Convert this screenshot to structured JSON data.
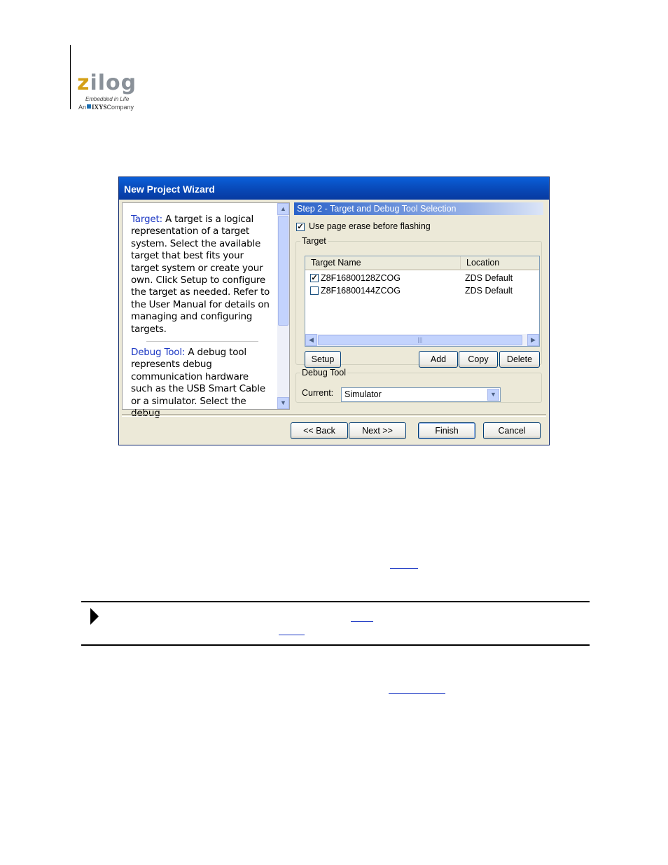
{
  "logo": {
    "wordmark_first": "z",
    "wordmark_rest": "ilog",
    "tagline": "Embedded in Life",
    "company_prefix": "An",
    "company_name": "IXYS",
    "company_suffix": "Company"
  },
  "dialog": {
    "title": "New Project Wizard",
    "help": {
      "target_term": "Target:",
      "target_text": " A target is a logical representation of a target system. Select the available target that best fits your target system or create your own. Click Setup to configure the target as needed. Refer to the User Manual for details on managing and configuring targets.",
      "debug_term": "Debug Tool:",
      "debug_text": " A debug tool represents debug communication hardware such as the USB Smart Cable or a simulator. Select the debug"
    },
    "step_title": "Step 2 - Target and Debug Tool Selection",
    "page_erase_label": "Use page erase before flashing",
    "target_group": {
      "legend": "Target",
      "columns": [
        "Target Name",
        "Location"
      ],
      "rows": [
        {
          "name": "Z8F16800128ZCOG",
          "location": "ZDS Default",
          "checked": true
        },
        {
          "name": "Z8F16800144ZCOG",
          "location": "ZDS Default",
          "checked": false
        }
      ],
      "buttons": {
        "setup": "Setup",
        "add": "Add",
        "copy": "Copy",
        "delete": "Delete"
      }
    },
    "debug_group": {
      "legend": "Debug Tool",
      "current_label": "Current:",
      "current_value": "Simulator"
    },
    "nav": {
      "back": "<< Back",
      "next": "Next >>",
      "finish": "Finish",
      "cancel": "Cancel"
    }
  },
  "colors": {
    "title_bar": "#0a5fd8",
    "link_blue": "#1c38c4",
    "dialog_face": "#ece9d8"
  }
}
